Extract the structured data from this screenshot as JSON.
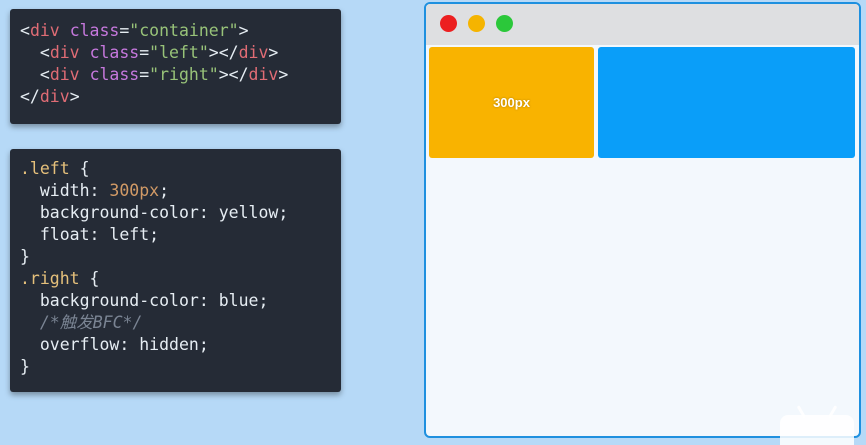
{
  "html_code": {
    "line1": {
      "open": "<",
      "tag": "div",
      "sp": " ",
      "attr": "class",
      "eq": "=",
      "val": "\"container\"",
      "close": ">"
    },
    "line2": {
      "indent": "  ",
      "open": "<",
      "tag": "div",
      "sp": " ",
      "attr": "class",
      "eq": "=",
      "val": "\"left\"",
      "close": "></",
      "tag2": "div",
      "end": ">"
    },
    "line3": {
      "indent": "  ",
      "open": "<",
      "tag": "div",
      "sp": " ",
      "attr": "class",
      "eq": "=",
      "val": "\"right\"",
      "close": "></",
      "tag2": "div",
      "end": ">"
    },
    "line4": {
      "open": "</",
      "tag": "div",
      "end": ">"
    }
  },
  "css_code": {
    "l1": {
      "sel": ".left",
      "rest": " {"
    },
    "l2": {
      "indent": "  ",
      "prop": "width",
      "colon": ": ",
      "val": "300px",
      "semi": ";"
    },
    "l3": {
      "indent": "  ",
      "prop": "background-color",
      "colon": ": ",
      "val": "yellow",
      "semi": ";"
    },
    "l4": {
      "indent": "  ",
      "prop": "float",
      "colon": ": ",
      "val": "left",
      "semi": ";"
    },
    "l5": {
      "text": "}"
    },
    "l6": {
      "sel": ".right",
      "rest": " {"
    },
    "l7": {
      "indent": "  ",
      "prop": "background-color",
      "colon": ": ",
      "val": "blue",
      "semi": ";"
    },
    "l8": {
      "indent": "  ",
      "comment": "/*触发BFC*/"
    },
    "l9": {
      "indent": "  ",
      "prop": "overflow",
      "colon": ": ",
      "val": "hidden",
      "semi": ";"
    },
    "l10": {
      "text": "}"
    }
  },
  "browser": {
    "left_box_label": "300px",
    "colors": {
      "left": "#f9b300",
      "right": "#0a9ef9",
      "close": "#ec1f20",
      "minimize": "#f5b400",
      "maximize": "#2bc83a"
    }
  }
}
